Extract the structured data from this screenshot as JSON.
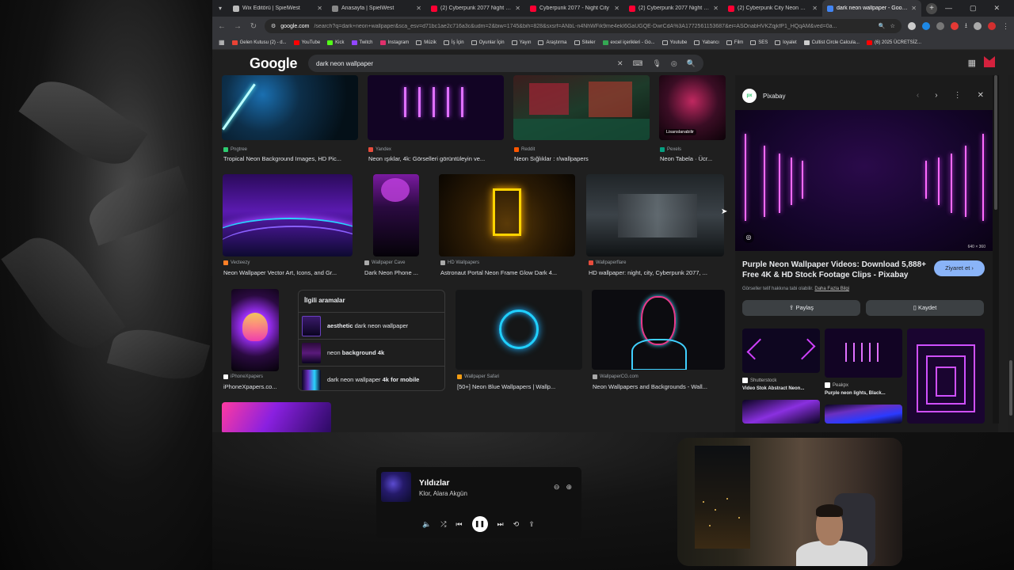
{
  "tabs": [
    {
      "title": "Wix Editörü | SpielWest",
      "color": "#bbbbbb"
    },
    {
      "title": "Anasayfa | SpielWest",
      "color": "#888888"
    },
    {
      "title": "(2) Cyberpunk 2077 Night City",
      "color": "#ff0033"
    },
    {
      "title": "Cyberpunk 2077 - Night City",
      "color": "#ff0033"
    },
    {
      "title": "(2) Cyberpunk 2077 Night City",
      "color": "#ff0033"
    },
    {
      "title": "(2) Cyberpunk City Neon Nigh",
      "color": "#ff0033"
    },
    {
      "title": "dark neon wallpaper - Google",
      "color": "#4285f4"
    }
  ],
  "address": {
    "domain": "google.com",
    "rest": "/search?q=dark+neon+wallpaper&sca_esv=d71bc1ae2c716a3c&udm=2&biw=1745&bih=828&sxsrf=ANbL-n4NhWFik9me4ekI6GaUGQE-DwrCdA%3A1772561153687&ei=ASOnabHVKZqjkfP1_HQqAM&ved=0a..."
  },
  "bookmarks": [
    {
      "label": "Gelen Kutusu (2) - d...",
      "color": "#ea4335"
    },
    {
      "label": "YouTube",
      "color": "#ff0000"
    },
    {
      "label": "Kick",
      "color": "#53fc18"
    },
    {
      "label": "Twitch",
      "color": "#9146ff"
    },
    {
      "label": "Instagram",
      "color": "#e1306c"
    },
    {
      "label": "Müzik",
      "color": "#888888"
    },
    {
      "label": "İş İçin",
      "color": "#888888"
    },
    {
      "label": "Oyunlar İçin",
      "color": "#888888"
    },
    {
      "label": "Yayın",
      "color": "#888888"
    },
    {
      "label": "Araştırma",
      "color": "#888888"
    },
    {
      "label": "Siteler",
      "color": "#888888"
    },
    {
      "label": "excel içerikleri - Go...",
      "color": "#34a853"
    },
    {
      "label": "Youtube",
      "color": "#888888"
    },
    {
      "label": "Yabancı",
      "color": "#888888"
    },
    {
      "label": "Film",
      "color": "#888888"
    },
    {
      "label": "SES",
      "color": "#888888"
    },
    {
      "label": "loyalet",
      "color": "#888888"
    },
    {
      "label": "Cultist Circle Calcula...",
      "color": "#cccccc"
    },
    {
      "label": "(6) 2025 ÜCRETSİZ...",
      "color": "#ff0000"
    }
  ],
  "google": {
    "logo": "Google",
    "query": "dark neon wallpaper"
  },
  "results_row1": [
    {
      "source": "Pngtree",
      "caption": "Tropical Neon Background Images, HD Pic...",
      "fav": "#2ecc71"
    },
    {
      "source": "Yandex",
      "caption": "Neon ışıklar, 4k: Görselleri görüntüleyin ve...",
      "fav": "#e74c3c"
    },
    {
      "source": "Reddit",
      "caption": "Neon Sığlıklar : r/wallpapers",
      "fav": "#ff5700"
    },
    {
      "source": "Pexels",
      "caption": "Neon Tabela · Ücr...",
      "fav": "#05a081",
      "license": "Lisanslanabilir"
    }
  ],
  "results_row2": [
    {
      "source": "Vecteezy",
      "caption": "Neon Wallpaper Vector Art, Icons, and Gr...",
      "fav": "#ff7f27"
    },
    {
      "source": "Wallpaper Cave",
      "caption": "Dark Neon Phone ...",
      "fav": "#aaaaaa"
    },
    {
      "source": "HD Wallpapers",
      "caption": "Astronaut Portal Neon Frame Glow Dark 4...",
      "fav": "#aaaaaa"
    },
    {
      "source": "Wallpaperflare",
      "caption": "HD wallpaper: night, city, Cyberpunk 2077, ...",
      "fav": "#e74c3c"
    }
  ],
  "results_row3": [
    {
      "source": "iPhoneXpapers",
      "caption": "iPhoneXpapers.co...",
      "fav": "#ffffff"
    },
    {
      "source": "Wallpaper Safari",
      "caption": "[50+] Neon Blue Wallpapers | Wallp...",
      "fav": "#f39c12"
    },
    {
      "source": "WallpaperCG.com",
      "caption": "Neon Wallpapers and Backgrounds - Wall...",
      "fav": "#aaaaaa"
    }
  ],
  "related": {
    "title": "İlgili aramalar",
    "items": [
      {
        "bold": "aesthetic",
        "text": " dark neon wallpaper"
      },
      {
        "bold": "",
        "text": "neon ",
        "bold2": "background 4k"
      },
      {
        "bold": "",
        "text": "dark neon wallpaper ",
        "bold2": "4k for mobile"
      }
    ]
  },
  "panel": {
    "source": "Pixabay",
    "logo_text": "px",
    "dims": "640 × 360",
    "title": "Purple Neon Wallpaper Videos: Download 5,888+ Free 4K & HD Stock Footage Clips - Pixabay",
    "visit": "Ziyaret et",
    "note": "Görseller telif hakkına tabi olabilir.",
    "note_link": "Daha Fazla Bilgi",
    "share": "Paylaş",
    "save": "Kaydet",
    "related": [
      {
        "source": "Shutterstock",
        "caption": "Video Stok Abstract Neon..."
      },
      {
        "source": "Peakpx",
        "caption": "Purple neon lights, Black..."
      }
    ]
  },
  "player": {
    "song": "Yıldızlar",
    "artist": "Klor, Alara Akgün"
  }
}
